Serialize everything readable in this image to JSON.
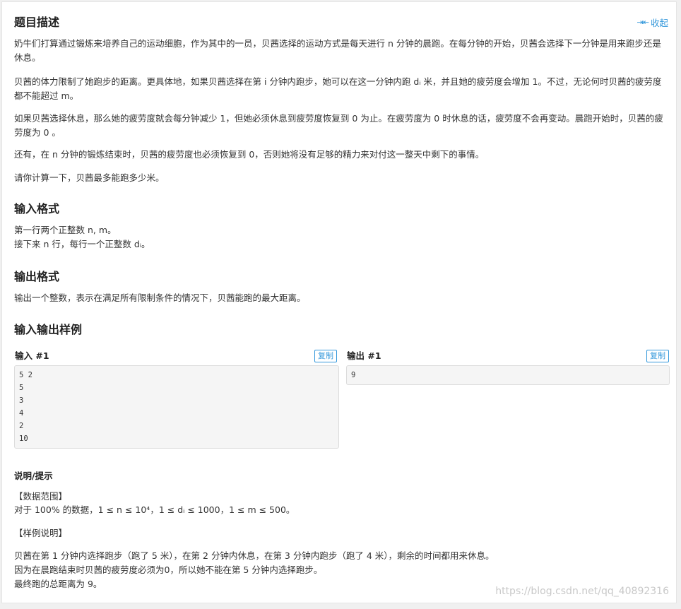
{
  "header": {
    "title": "题目描述",
    "collapse_label": "收起"
  },
  "description": {
    "p1": "奶牛们打算通过锻炼来培养自己的运动细胞，作为其中的一员，贝茜选择的运动方式是每天进行 n 分钟的晨跑。在每分钟的开始，贝茜会选择下一分钟是用来跑步还是休息。",
    "p2": "贝茜的体力限制了她跑步的距离。更具体地，如果贝茜选择在第 i 分钟内跑步，她可以在这一分钟内跑 dᵢ 米，并且她的疲劳度会增加 1。不过，无论何时贝茜的疲劳度都不能超过 m。",
    "p3": "如果贝茜选择休息，那么她的疲劳度就会每分钟减少 1，但她必须休息到疲劳度恢复到 0 为止。在疲劳度为 0 时休息的话，疲劳度不会再变动。晨跑开始时，贝茜的疲劳度为 0 。",
    "p4": "还有，在 n 分钟的锻炼结束时，贝茜的疲劳度也必须恢复到 0，否则她将没有足够的精力来对付这一整天中剩下的事情。",
    "p5": "请你计算一下，贝茜最多能跑多少米。"
  },
  "input_format": {
    "title": "输入格式",
    "line1": "第一行两个正整数 n, m。",
    "line2": "接下来 n 行，每行一个正整数 dᵢ。"
  },
  "output_format": {
    "title": "输出格式",
    "line1": "输出一个整数，表示在满足所有限制条件的情况下，贝茜能跑的最大距离。"
  },
  "samples": {
    "title": "输入输出样例",
    "input_label": "输入 #1",
    "output_label": "输出 #1",
    "copy_label": "复制",
    "input_lines": [
      "5 2",
      "5",
      "3",
      "4",
      "2",
      "10"
    ],
    "output_lines": [
      "9"
    ]
  },
  "hint": {
    "title": "说明/提示",
    "range_head": "【数据范围】",
    "range_text": "对于 100% 的数据，1 ≤ n ≤ 10⁴，1 ≤ dᵢ ≤ 1000，1 ≤ m ≤ 500。",
    "example_head": "【样例说明】",
    "ex1": "贝茜在第 1 分钟内选择跑步（跑了 5 米），在第 2 分钟内休息，在第 3 分钟内跑步（跑了 4 米），剩余的时间都用来休息。",
    "ex2": "因为在晨跑结束时贝茜的疲劳度必须为0，所以她不能在第 5 分钟内选择跑步。",
    "ex3": "最终跑的总距离为 9。"
  },
  "watermark": "https://blog.csdn.net/qq_40892316"
}
